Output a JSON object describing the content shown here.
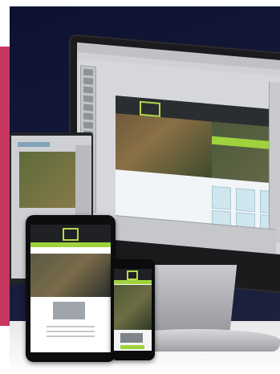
{
  "scene": {
    "description_colors": {
      "accent_green": "#9fd33d",
      "pink_strip": "#c8375f",
      "background_dark": "#0d1230"
    },
    "devices": [
      "monitor",
      "laptop",
      "tablet",
      "phone"
    ]
  }
}
